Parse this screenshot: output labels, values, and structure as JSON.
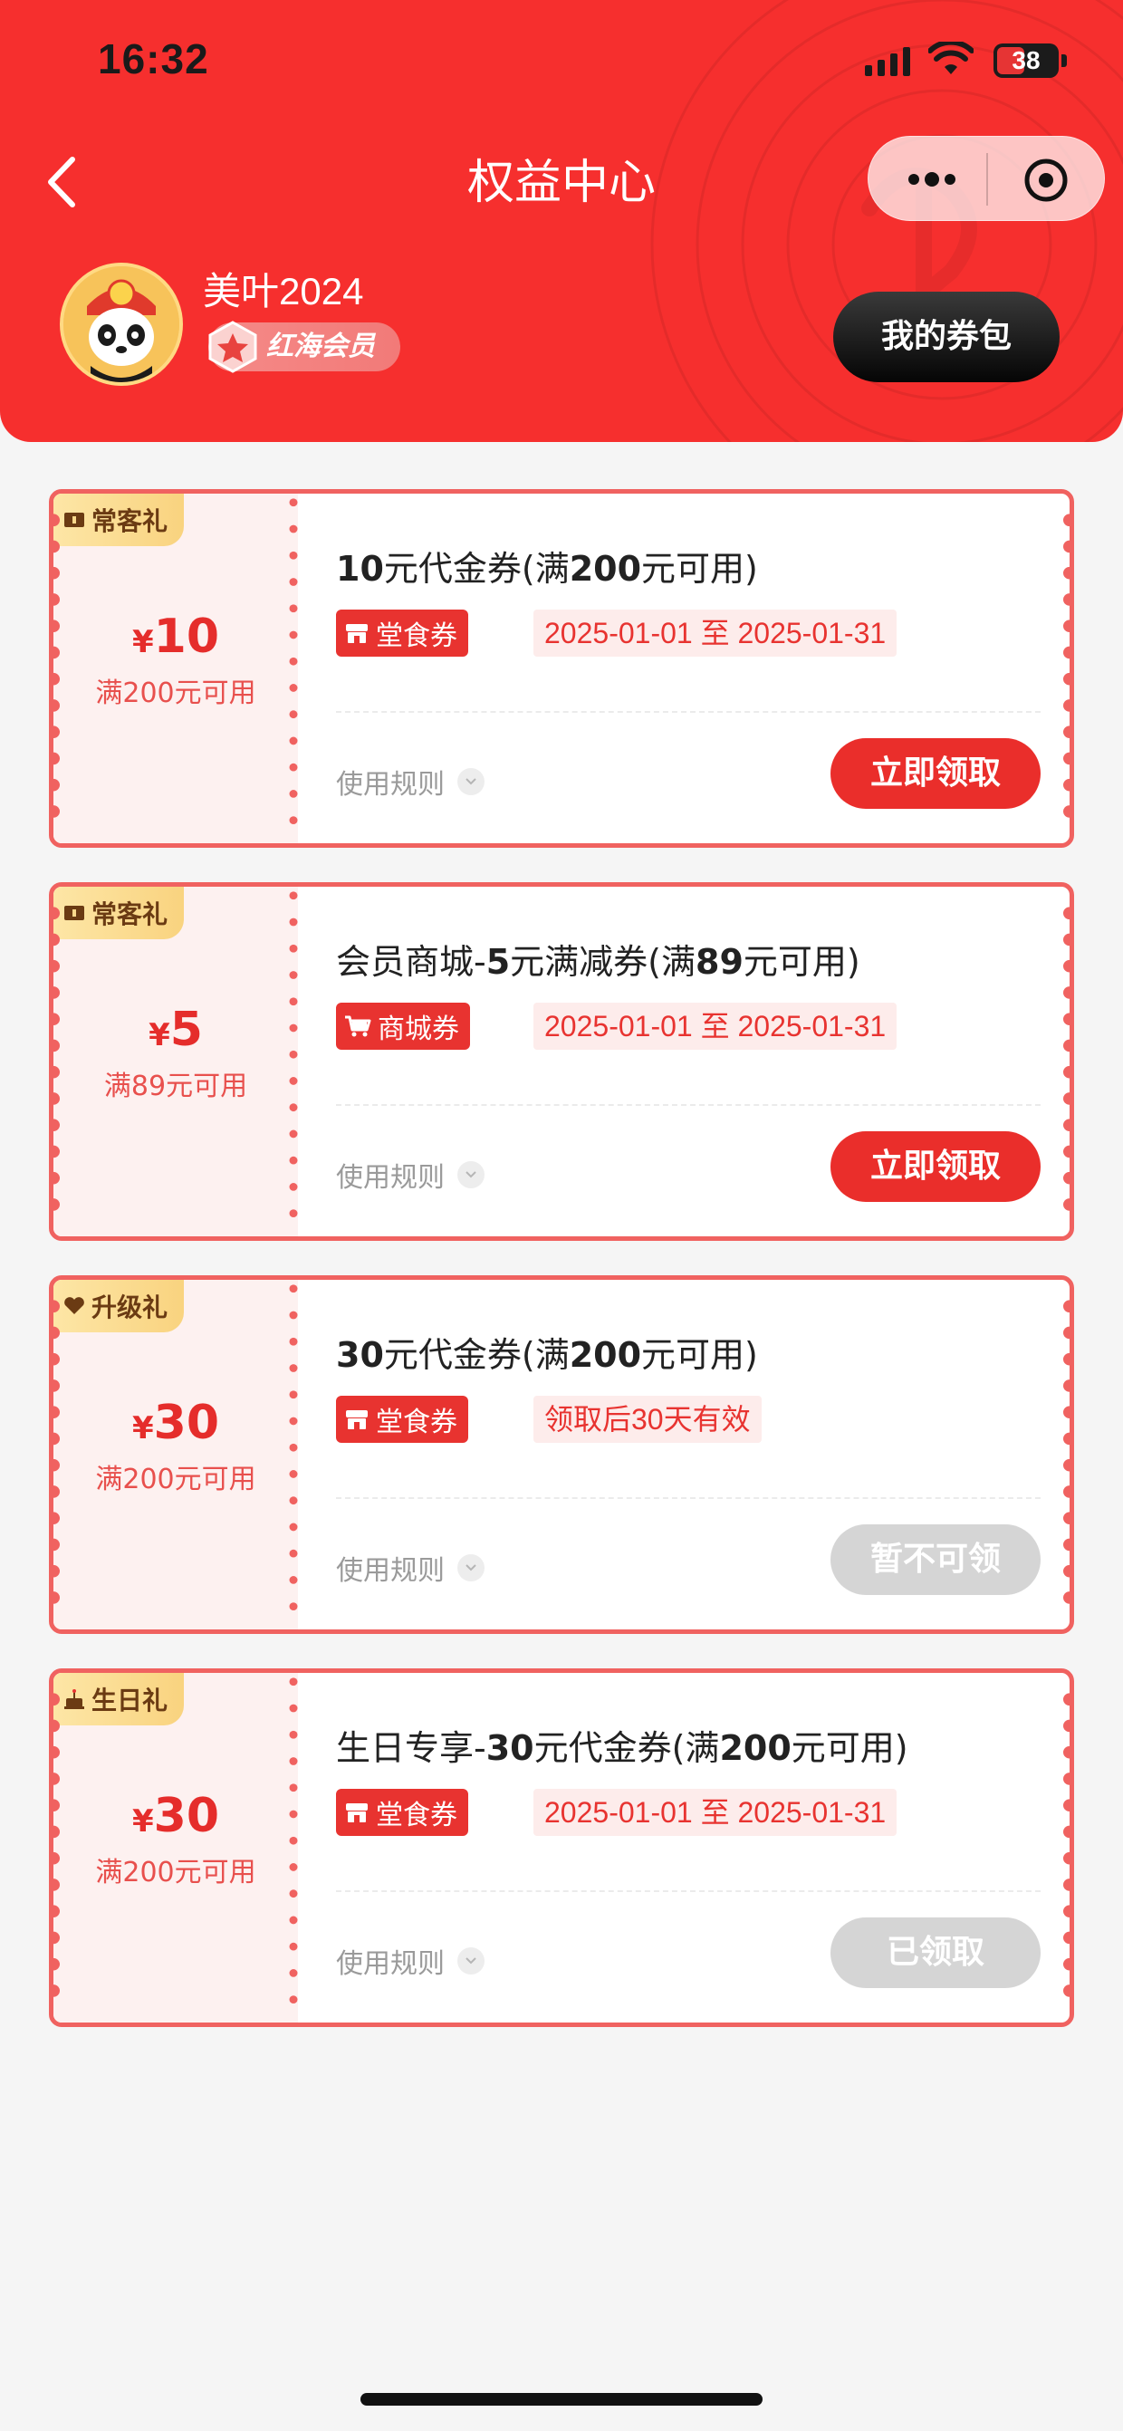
{
  "status_bar": {
    "time": "16:32",
    "battery": "38"
  },
  "nav": {
    "title": "权益中心"
  },
  "user": {
    "name": "美叶2024",
    "level": "红海会员",
    "wallet_button": "我的券包"
  },
  "colors": {
    "primary": "#f62f2e",
    "coupon_border": "#f06260",
    "tag_gold": "#f9d37f",
    "disabled": "#d5d5d5"
  },
  "coupons": [
    {
      "tag": "常客礼",
      "tag_icon": "ticket-icon",
      "currency": "¥",
      "amount": "10",
      "condition": "满200元可用",
      "title_a": "10",
      "title_b": "元代金券(满",
      "title_c": "200",
      "title_d": "元可用)",
      "type": "堂食券",
      "type_icon": "store-icon",
      "validity": "2025-01-01 至 2025-01-31",
      "rules": "使用规则",
      "action": "立即领取",
      "action_state": "enabled"
    },
    {
      "tag": "常客礼",
      "tag_icon": "ticket-icon",
      "currency": "¥",
      "amount": "5",
      "condition": "满89元可用",
      "title_a": "会员商城-",
      "title_b": "5",
      "title_c": "元满减券(满",
      "title_d": "89",
      "title_e": "元可用)",
      "type": "商城券",
      "type_icon": "cart-icon",
      "validity": "2025-01-01 至 2025-01-31",
      "rules": "使用规则",
      "action": "立即领取",
      "action_state": "enabled"
    },
    {
      "tag": "升级礼",
      "tag_icon": "heart-icon",
      "currency": "¥",
      "amount": "30",
      "condition": "满200元可用",
      "title_a": "30",
      "title_b": "元代金券(满",
      "title_c": "200",
      "title_d": "元可用)",
      "type": "堂食券",
      "type_icon": "store-icon",
      "validity": "领取后30天有效",
      "rules": "使用规则",
      "action": "暂不可领",
      "action_state": "disabled"
    },
    {
      "tag": "生日礼",
      "tag_icon": "cake-icon",
      "currency": "¥",
      "amount": "30",
      "condition": "满200元可用",
      "title_a": "生日专享-",
      "title_b": "30",
      "title_c": "元代金券(满",
      "title_d": "200",
      "title_e": "元可用)",
      "type": "堂食券",
      "type_icon": "store-icon",
      "validity": "2025-01-01 至 2025-01-31",
      "rules": "使用规则",
      "action": "已领取",
      "action_state": "disabled"
    }
  ]
}
